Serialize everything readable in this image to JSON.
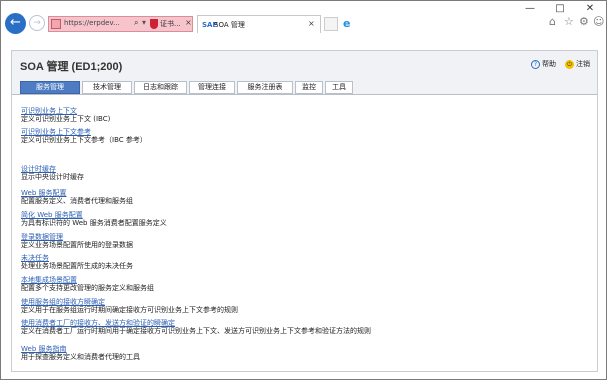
{
  "browser": {
    "address_url": "https://erpdev...",
    "search_glyph": "⌕",
    "refresh_glyph": "↻",
    "cert_label": "证书...",
    "close_glyph": "×",
    "tab_logo": "SAP",
    "tab_title": "SOA 管理",
    "window_controls": [
      "—",
      "□",
      "✕"
    ],
    "toolbar_icons": [
      "home-icon",
      "star-icon",
      "gear-icon",
      "smiley-icon"
    ]
  },
  "page": {
    "title": "SOA 管理 (ED1;200)",
    "help_label": "帮助",
    "logout_label": "注销",
    "tabs": [
      {
        "label": "服务管理",
        "active": true
      },
      {
        "label": "技术管理",
        "active": false
      },
      {
        "label": "日志和跟踪",
        "active": false
      },
      {
        "label": "管理连接",
        "active": false
      },
      {
        "label": "服务注册表",
        "active": false
      },
      {
        "label": "监控",
        "active": false
      },
      {
        "label": "工具",
        "active": false
      }
    ]
  },
  "items": [
    {
      "link": "可识别业务上下文",
      "desc": "定义可识别业务上下文 (IBC)"
    },
    {
      "link": "可识别业务上下文参考",
      "desc": "定义可识别业务上下文参考（IBC 参考）"
    },
    {
      "link": "设计时缓存",
      "desc": "显示中央设计时缓存"
    },
    {
      "link": "Web 服务配置",
      "desc": "配置服务定义、消费者代理和服务组"
    },
    {
      "link": "简化 Web 服务配置",
      "desc": "为具有标识符的 Web 服务消费者配置服务定义"
    },
    {
      "link": "登录数据管理",
      "desc": "定义业务场景配置所使用的登录数据"
    },
    {
      "link": "未决任务",
      "desc": "处理业务场景配置所生成的未决任务"
    },
    {
      "link": "本地集成场景配置",
      "desc": "配置多个支持更改管理的服务定义和服务组"
    },
    {
      "link": "使用服务组的接收方瞬确定",
      "desc": "定义用于在服务组运行时期间确定接收方可识别业务上下文参考的规则"
    },
    {
      "link": "使用消费者工厂的接收方、发送方和验证的瞬确定",
      "desc": "定义在消费者工厂运行时期间用于确定接收方可识别业务上下文、发送方可识别业务上下文参考和验证方法的规则"
    },
    {
      "link": "Web 服务指南",
      "desc": "用于探查服务定义和消费者代理的工具"
    }
  ]
}
